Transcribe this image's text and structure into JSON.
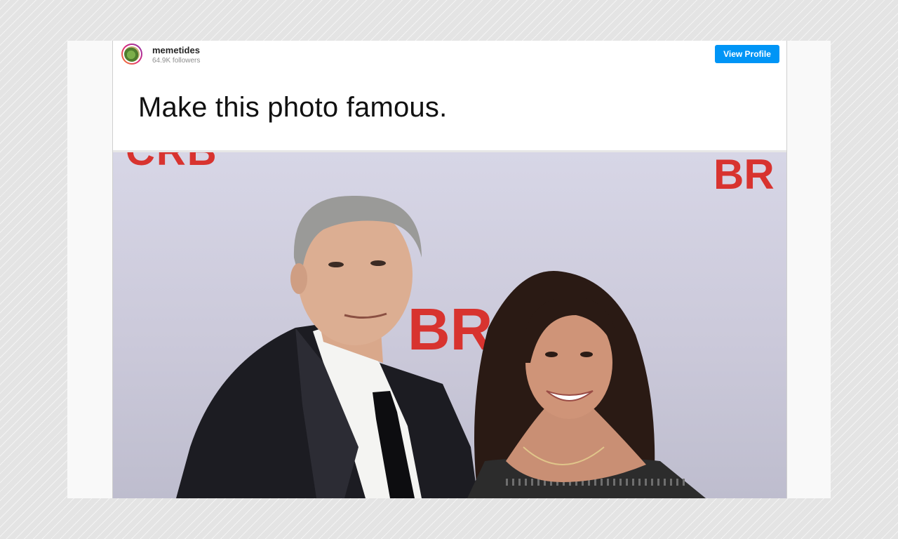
{
  "post": {
    "username": "memetides",
    "followers": "64.9K followers",
    "view_profile_label": "View Profile",
    "caption": "Make this photo famous."
  },
  "photo": {
    "backdrop_text": [
      "CRB",
      "BR",
      "BRO"
    ]
  },
  "colors": {
    "button_blue": "#0095f6",
    "backdrop_red": "#d8332f"
  }
}
